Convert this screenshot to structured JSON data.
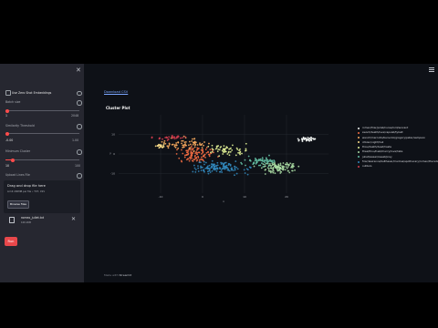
{
  "sidebar": {
    "zero_shot_label": "Use Zero Shot Embeddings",
    "batch_size": {
      "label": "Batch size",
      "value": "1",
      "min": "1",
      "max": "2048"
    },
    "similarity_threshold": {
      "label": "Similarity Threshold",
      "min": "-0.00",
      "max": "1.00"
    },
    "min_cluster": {
      "label": "Minimum Cluster",
      "value": "10",
      "max": "100"
    },
    "upload": {
      "label": "Upload Lines File",
      "drop_title": "Drag and drop file here",
      "drop_hint": "Limit 200MB per file • TXT, CSV",
      "browse_label": "Browse files",
      "file_name": "romeo_juliet.txt",
      "file_size": "100.2KB"
    },
    "run_label": "Run"
  },
  "main": {
    "download_link": "Download CSV",
    "plot_title": "Cluster Plot",
    "footer_prefix": "Made with",
    "footer_brand": "Streamlit"
  },
  "chart_data": {
    "type": "scatter",
    "title": "Cluster Plot",
    "xlabel": "x",
    "ylabel": "y",
    "xlim": [
      -20,
      30
    ],
    "ylim": [
      -20,
      20
    ],
    "x_ticks": [
      "-10",
      "0",
      "10",
      "20"
    ],
    "y_ticks": [
      "10",
      "0",
      "-10"
    ],
    "grid": true,
    "legend_position": "right",
    "series": [
      {
        "name": "romeo/friar/juliet/nurse/lord/servant",
        "color": "#f3f6f4",
        "center": [
          25,
          7.5
        ],
        "spread": [
          2.2,
          1.0
        ],
        "n": 45
      },
      {
        "name": "sword/death/love/capulet/tybalt",
        "color": "#f46d43",
        "center": [
          -2,
          0
        ],
        "spread": [
          4.0,
          4.0
        ],
        "n": 110
      },
      {
        "name": "wench/mercutio/benvolio/gregory/peter/sampson",
        "color": "#fdae61",
        "center": [
          -4,
          5
        ],
        "spread": [
          5.0,
          3.0
        ],
        "n": 70
      },
      {
        "name": "citizen/night/hail",
        "color": "#fee08b",
        "center": [
          -10,
          4
        ],
        "spread": [
          1.2,
          1.0
        ],
        "n": 20
      },
      {
        "name": "thou/death/dead/haste",
        "color": "#e6f598",
        "center": [
          6,
          2
        ],
        "spread": [
          5.0,
          2.5
        ],
        "n": 60
      },
      {
        "name": "thee/thou/hast/mercy/love/hate",
        "color": "#abdda4",
        "center": [
          18,
          -7
        ],
        "spread": [
          4.0,
          2.5
        ],
        "n": 120
      },
      {
        "name": "juliet/swear/sweet/prey",
        "color": "#66c2a5",
        "center": [
          14,
          -4
        ],
        "spread": [
          4.0,
          2.5
        ],
        "n": 60
      },
      {
        "name": "friar/lawrence/balthasar/mantua/apothecary/romeo/thursday",
        "color": "#3288bd",
        "center": [
          4,
          -7
        ],
        "spread": [
          6.0,
          3.0
        ],
        "n": 140
      },
      {
        "name": "outliers",
        "color": "#d53e4f",
        "center": [
          -8,
          8.5
        ],
        "spread": [
          4.0,
          1.0
        ],
        "n": 30
      }
    ]
  }
}
